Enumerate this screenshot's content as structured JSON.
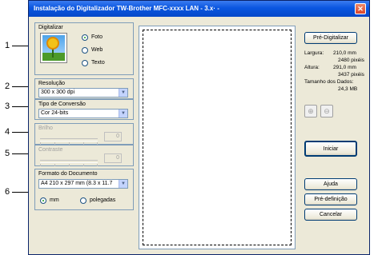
{
  "window": {
    "title": "Instalação do Digitalizador TW-Brother MFC-xxxx   LAN - 3.x· -"
  },
  "callouts": [
    "1",
    "2",
    "3",
    "4",
    "5",
    "6"
  ],
  "scan": {
    "label": "Digitalizar",
    "options": [
      {
        "label": "Foto",
        "checked": true
      },
      {
        "label": "Web",
        "checked": false
      },
      {
        "label": "Texto",
        "checked": false
      }
    ]
  },
  "resolution": {
    "label": "Resolução",
    "value": "300 x 300 dpi"
  },
  "conversion": {
    "label": "Tipo de Conversão",
    "value": "Cor 24-bits"
  },
  "brightness": {
    "label": "Brilho",
    "value": "0"
  },
  "contrast": {
    "label": "Contraste",
    "value": "0"
  },
  "document": {
    "label": "Formato do Documento",
    "value": "A4 210 x 297 mm (8.3 x 11.7",
    "units": [
      {
        "label": "mm",
        "checked": true
      },
      {
        "label": "polegadas",
        "checked": false
      }
    ]
  },
  "right": {
    "prescan": "Pré-Digitalizar",
    "width_label": "Largura:",
    "width_mm": "210,0 mm",
    "width_px": "2480 pixéis",
    "height_label": "Altura:",
    "height_mm": "291,0 mm",
    "height_px": "3437 pixéis",
    "size_label": "Tamanho dos Dados:",
    "size_value": "24,3 MB",
    "start": "Iniciar",
    "help": "Ajuda",
    "preset": "Pré-definição",
    "cancel": "Cancelar"
  }
}
